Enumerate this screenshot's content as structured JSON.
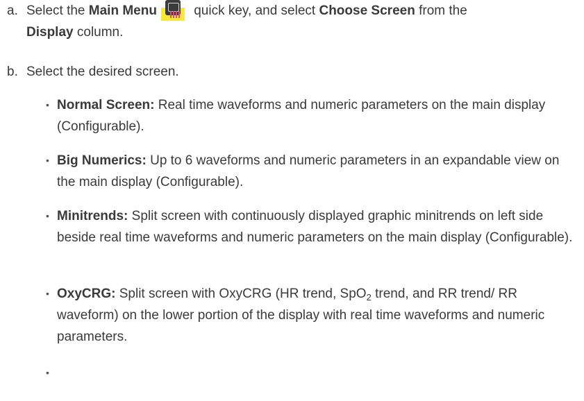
{
  "steps": {
    "a": {
      "letter": "a.",
      "pre": "Select the ",
      "main_menu": "Main Menu",
      "icon": "main-menu-quick-key-icon",
      "mid": " quick key, and  select ",
      "choose_screen": "Choose Screen",
      "mid2": " from the",
      "display": "Display",
      "post": " column."
    },
    "b": {
      "letter": "b.",
      "text": "Select the desired screen."
    }
  },
  "bullets": {
    "normal": {
      "title": "Normal Screen:",
      "text": " Real time waveforms and numeric parameters on the main display (Configurable)."
    },
    "big": {
      "title": "Big Numerics:",
      "text": " Up to 6 waveforms and numeric parameters in an expandable view on the main display (Configurable)."
    },
    "minitrends": {
      "title": "Minitrends:",
      "text": " Split screen with continuously displayed graphic minitrends on left side beside real time waveforms and numeric parameters on the main display (Configurable)."
    },
    "oxycrg": {
      "title": "OxyCRG:",
      "text1": " Split screen with OxyCRG (HR trend, SpO",
      "sub": "2",
      "text2": " trend, and RR trend/ RR waveform) on the lower portion of the display with real time waveforms and numeric parameters."
    },
    "dot": "•"
  }
}
